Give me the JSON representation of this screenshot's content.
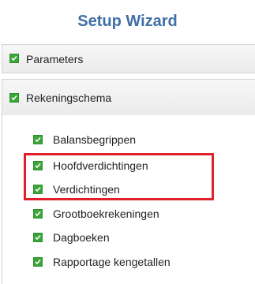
{
  "title": "Setup Wizard",
  "colors": {
    "title": "#3f6fa8",
    "check": "#3aa63a",
    "highlight": "#e0202a"
  },
  "sections": [
    {
      "label": "Parameters",
      "icon": "check-icon"
    },
    {
      "label": "Rekeningschema",
      "icon": "check-icon"
    }
  ],
  "items": [
    {
      "label": "Balansbegrippen",
      "icon": "check-icon"
    },
    {
      "label": "Hoofdverdichtingen",
      "icon": "check-icon"
    },
    {
      "label": "Verdichtingen",
      "icon": "check-icon"
    },
    {
      "label": "Grootboekrekeningen",
      "icon": "check-icon"
    },
    {
      "label": "Dagboeken",
      "icon": "check-icon"
    },
    {
      "label": "Rapportage kengetallen",
      "icon": "check-icon"
    }
  ]
}
